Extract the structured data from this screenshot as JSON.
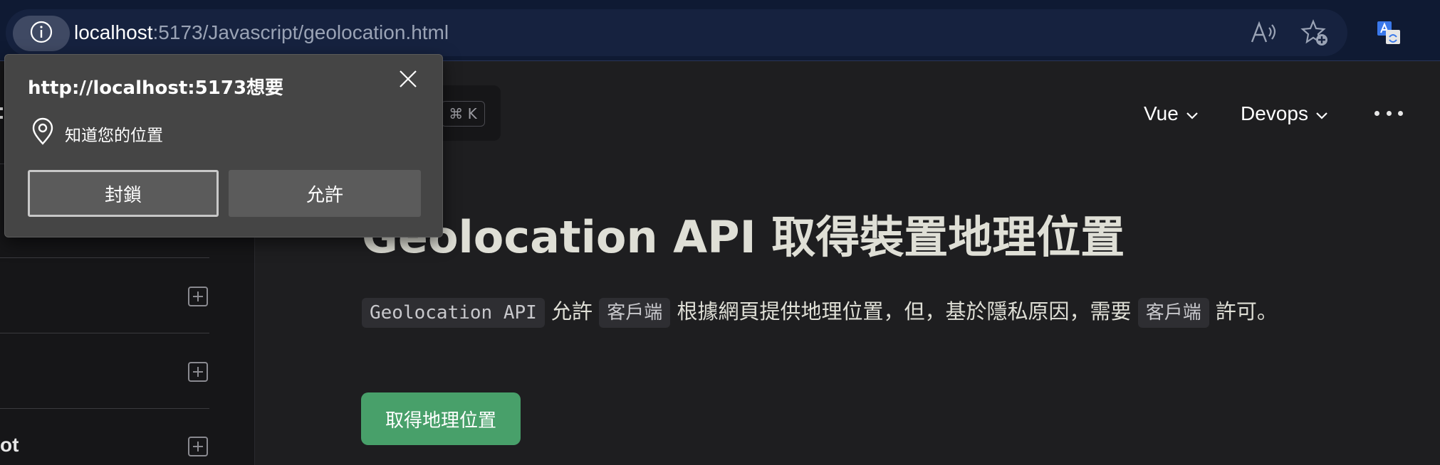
{
  "browser": {
    "url_host": "localhost",
    "url_path": ":5173/Javascript/geolocation.html",
    "icons": [
      "info-icon",
      "read-aloud-icon",
      "add-favorite-icon",
      "translate-icon"
    ]
  },
  "header": {
    "search_shortcut": "⌘ K",
    "nav": [
      {
        "label": "Vue"
      },
      {
        "label": "Devops"
      }
    ]
  },
  "sidebar": {
    "partial_label": "ot"
  },
  "main": {
    "title": "Geolocation API 取得裝置地理位置",
    "intro_code_1": "Geolocation API",
    "intro_text_1": " 允許 ",
    "intro_code_2": "客戶端",
    "intro_text_2": " 根據網頁提供地理位置，但，基於隱私原因，需要 ",
    "intro_code_3": "客戶端",
    "intro_text_3": " 許可。",
    "button_label": "取得地理位置",
    "button_color": "#48a06a"
  },
  "popup": {
    "title": "http://localhost:5173想要",
    "permission": "知道您的位置",
    "block_label": "封鎖",
    "allow_label": "允許"
  }
}
